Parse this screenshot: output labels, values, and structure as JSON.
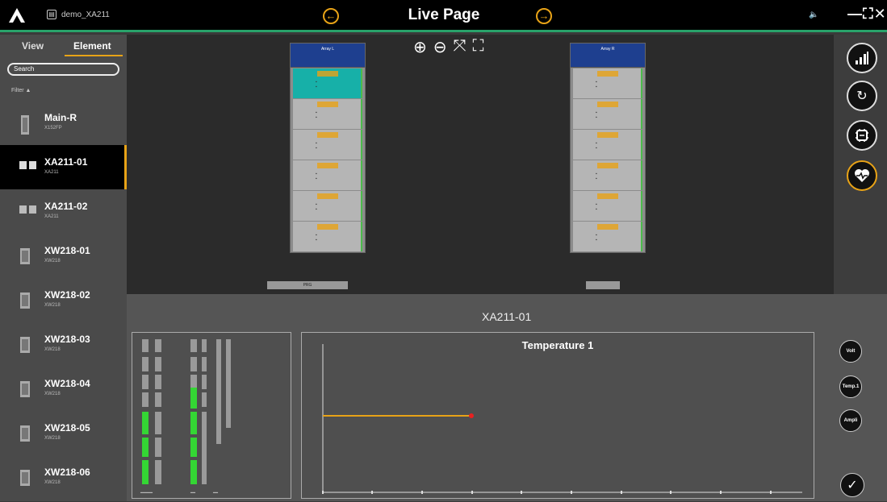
{
  "header": {
    "filename": "demo_XA211",
    "title": "Live Page",
    "controls": "—⛶✕"
  },
  "sidebar": {
    "tabs": [
      "View",
      "Element"
    ],
    "search_placeholder": "Search",
    "filter_label": "Filter ▲",
    "devices": [
      {
        "name": "Main-R",
        "sub": "X152FP"
      },
      {
        "name": "XA211-01",
        "sub": "XA211"
      },
      {
        "name": "XA211-02",
        "sub": "XA211"
      },
      {
        "name": "XW218-01",
        "sub": "XW218"
      },
      {
        "name": "XW218-02",
        "sub": "XW218"
      },
      {
        "name": "XW218-03",
        "sub": "XW218"
      },
      {
        "name": "XW218-04",
        "sub": "XW218"
      },
      {
        "name": "XW218-05",
        "sub": "XW218"
      },
      {
        "name": "XW218-06",
        "sub": "XW218"
      }
    ]
  },
  "racks": [
    {
      "name": "Array L",
      "tab": "PRG"
    },
    {
      "name": "Array R",
      "tab": ""
    }
  ],
  "bottom": {
    "device_title": "XA211-01",
    "chart_title": "Temperature 1",
    "side_buttons": [
      "Volt",
      "Temp.1",
      "Ampli"
    ]
  },
  "colors": {
    "accent": "#e8a317",
    "green_line": "#29a36a",
    "selected_slot": "#17b0a8",
    "rack_header": "#1e3f8f"
  }
}
